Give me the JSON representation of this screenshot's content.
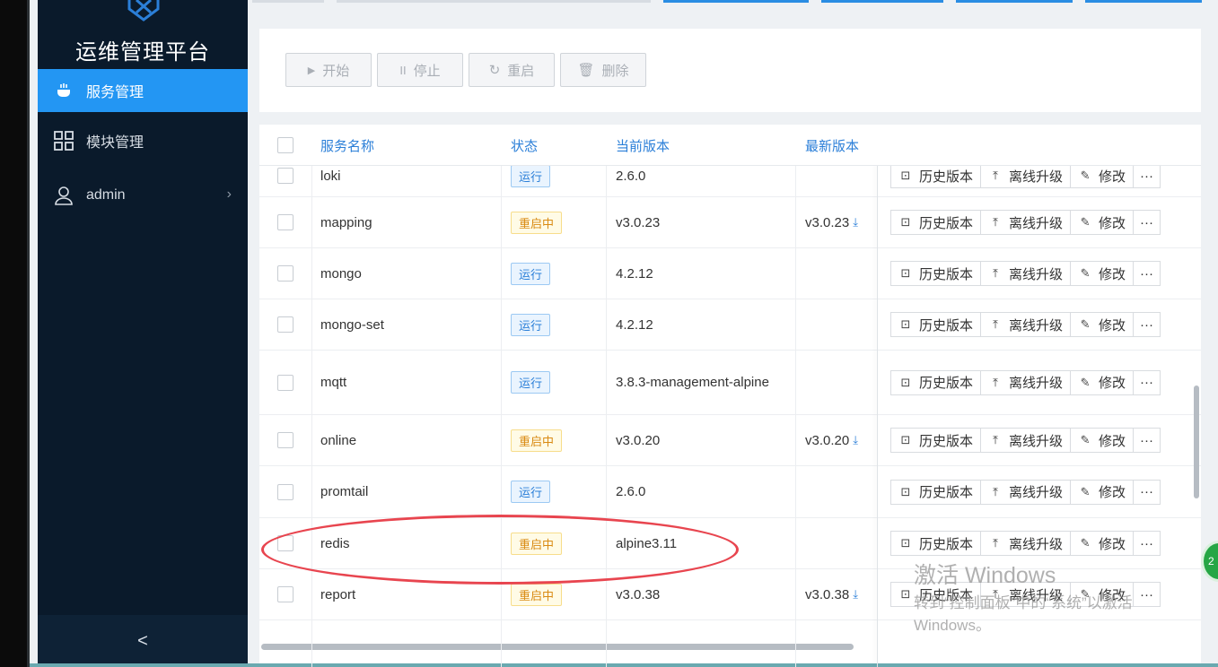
{
  "sidebar": {
    "brand": "运维管理平台",
    "items": [
      {
        "label": "服务管理",
        "icon": "service-icon",
        "active": true
      },
      {
        "label": "模块管理",
        "icon": "module-grid-icon",
        "active": false
      },
      {
        "label": "admin",
        "icon": "user-icon",
        "active": false
      }
    ],
    "collapse_glyph": "<"
  },
  "toolbar": {
    "start": "开始",
    "stop": "停止",
    "restart": "重启",
    "delete": "删除"
  },
  "table": {
    "headers": {
      "name": "服务名称",
      "status": "状态",
      "current_version": "当前版本",
      "latest_version": "最新版本"
    },
    "actions": {
      "history": "历史版本",
      "offline_upgrade": "离线升级",
      "modify": "修改",
      "more": "···"
    },
    "rows": [
      {
        "name": "loki",
        "status": "运行",
        "status_type": "run",
        "current": "2.6.0",
        "latest": ""
      },
      {
        "name": "mapping",
        "status": "重启中",
        "status_type": "restart",
        "current": "v3.0.23",
        "latest": "v3.0.23"
      },
      {
        "name": "mongo",
        "status": "运行",
        "status_type": "run",
        "current": "4.2.12",
        "latest": ""
      },
      {
        "name": "mongo-set",
        "status": "运行",
        "status_type": "run",
        "current": "4.2.12",
        "latest": ""
      },
      {
        "name": "mqtt",
        "status": "运行",
        "status_type": "run",
        "current": "3.8.3-management-alpine",
        "latest": ""
      },
      {
        "name": "online",
        "status": "重启中",
        "status_type": "restart",
        "current": "v3.0.20",
        "latest": "v3.0.20"
      },
      {
        "name": "promtail",
        "status": "运行",
        "status_type": "run",
        "current": "2.6.0",
        "latest": ""
      },
      {
        "name": "redis",
        "status": "重启中",
        "status_type": "restart",
        "current": "alpine3.11",
        "latest": ""
      },
      {
        "name": "report",
        "status": "重启中",
        "status_type": "restart",
        "current": "v3.0.38",
        "latest": "v3.0.38"
      }
    ]
  },
  "watermark": {
    "line1": "激活 Windows",
    "line2": "转到“控制面板”中的“系统”以激活",
    "line3": "Windows。"
  },
  "floating_badge": "2",
  "colors": {
    "accent": "#2396f3",
    "sidebar_bg": "#0a1a2b",
    "running": "#2b7fd8",
    "restarting": "#d98a12",
    "annotation": "#e8454f"
  }
}
